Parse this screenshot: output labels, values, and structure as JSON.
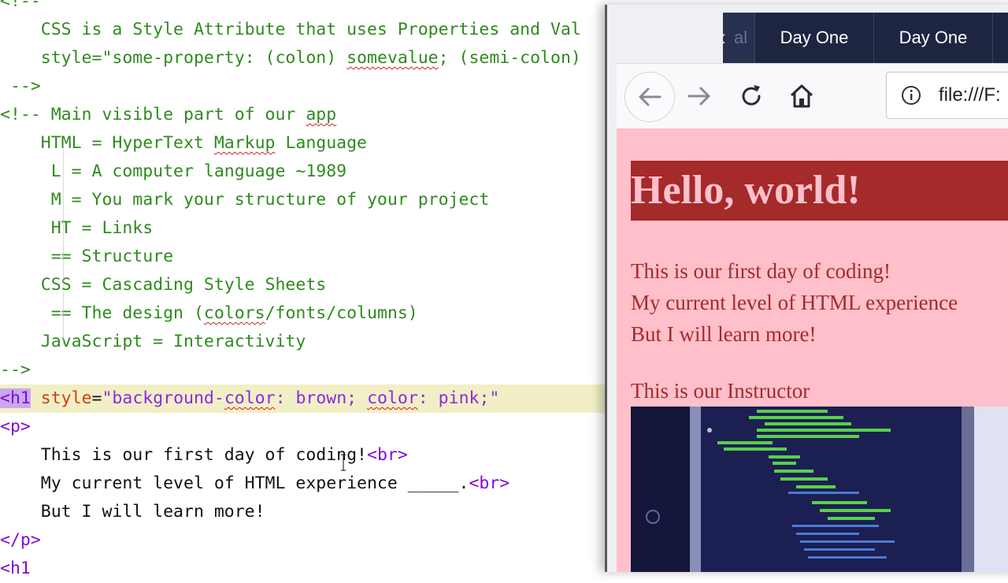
{
  "editor": {
    "lines": [
      {
        "parts": [
          {
            "t": "<!--",
            "c": "com"
          }
        ]
      },
      {
        "parts": [
          {
            "t": "    CSS is a Style Attribute that uses Properties and Val",
            "c": "com"
          }
        ]
      },
      {
        "parts": [
          {
            "t": "    style=\"some-property: (colon) ",
            "c": "com"
          },
          {
            "t": "somevalue",
            "c": "com sq"
          },
          {
            "t": "; (semi-colon)",
            "c": "com"
          }
        ]
      },
      {
        "parts": [
          {
            "t": " -->",
            "c": "com"
          }
        ]
      },
      {
        "parts": [
          {
            "t": "<!-- Main visible part of our ",
            "c": "com"
          },
          {
            "t": "app",
            "c": "com sq"
          }
        ]
      },
      {
        "parts": [
          {
            "t": "    HTML = HyperText ",
            "c": "com"
          },
          {
            "t": "Markup",
            "c": "com sq"
          },
          {
            "t": " Language",
            "c": "com"
          }
        ]
      },
      {
        "parts": [
          {
            "t": "     L = A computer language ~1989",
            "c": "com"
          }
        ]
      },
      {
        "parts": [
          {
            "t": "     M = You mark your structure of your project",
            "c": "com"
          }
        ]
      },
      {
        "parts": [
          {
            "t": "     HT = Links",
            "c": "com"
          }
        ]
      },
      {
        "parts": [
          {
            "t": "     == Structure",
            "c": "com"
          }
        ]
      },
      {
        "parts": [
          {
            "t": "    CSS = Cascading Style Sheets",
            "c": "com"
          }
        ]
      },
      {
        "parts": [
          {
            "t": "     == The design (",
            "c": "com"
          },
          {
            "t": "colors",
            "c": "com sq"
          },
          {
            "t": "/fonts/columns)",
            "c": "com"
          }
        ]
      },
      {
        "parts": [
          {
            "t": "    JavaScript = Interactivity",
            "c": "com"
          }
        ]
      },
      {
        "parts": [
          {
            "t": "-->",
            "c": "com"
          }
        ]
      },
      {
        "hl": true,
        "parts": [
          {
            "t": "<h1",
            "c": "tagsel"
          },
          {
            "t": " ",
            "c": "txt"
          },
          {
            "t": "style",
            "c": "attr"
          },
          {
            "t": "=",
            "c": "txt"
          },
          {
            "t": "\"background-",
            "c": "str"
          },
          {
            "t": "color",
            "c": "str sq"
          },
          {
            "t": ": brown; ",
            "c": "str"
          },
          {
            "t": "color",
            "c": "str sq"
          },
          {
            "t": ": pink;\"",
            "c": "str"
          }
        ]
      },
      {
        "parts": [
          {
            "t": "<p>",
            "c": "tag"
          }
        ]
      },
      {
        "parts": [
          {
            "t": "    This is our first day of coding!",
            "c": "txt"
          },
          {
            "t": "<br>",
            "c": "tag"
          }
        ]
      },
      {
        "parts": [
          {
            "t": "    My current level of HTML experience _____.",
            "c": "txt"
          },
          {
            "t": "<br>",
            "c": "tag"
          }
        ]
      },
      {
        "parts": [
          {
            "t": "    But I will learn more!",
            "c": "txt"
          }
        ]
      },
      {
        "parts": [
          {
            "t": "</p>",
            "c": "tag"
          }
        ]
      },
      {
        "parts": [
          {
            "t": "<h1",
            "c": "tag"
          }
        ]
      }
    ]
  },
  "browser": {
    "tabs": [
      {
        "label": "al"
      },
      {
        "label": "Day One"
      },
      {
        "label": "Day One"
      }
    ],
    "url": "file:///F:",
    "page": {
      "heading": "Hello, world!",
      "line1": "This is our first day of coding!",
      "line2": "My current level of HTML experience",
      "line3": "But I will learn more!",
      "instructor": "This is our Instructor"
    }
  },
  "colors": {
    "comment": "#2f8a1f",
    "tag": "#7f0ad8",
    "attr": "#d04010",
    "string": "#8a2be2",
    "h1_background": "#a52a2a",
    "h1_text": "#ffc0cb",
    "page_background": "#ffc0cb",
    "tab_bar": "#1d2541"
  },
  "icons": [
    "back-arrow-icon",
    "forward-arrow-icon",
    "reload-icon",
    "home-icon",
    "info-icon",
    "tab-scroll-left-icon"
  ]
}
